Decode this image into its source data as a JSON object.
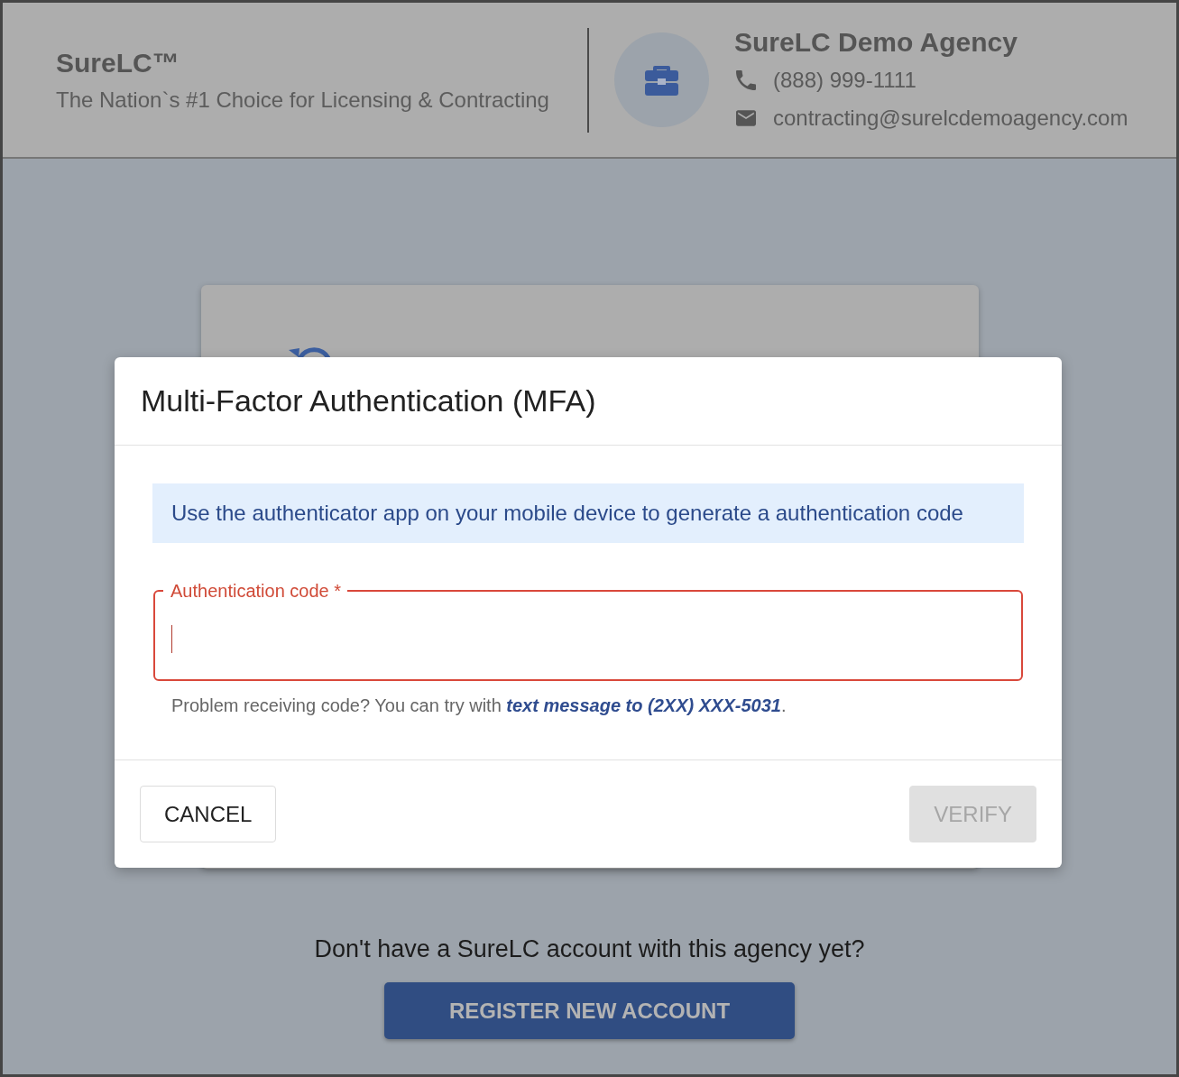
{
  "header": {
    "brand": {
      "name": "SureLC™",
      "tagline": "The Nation`s #1 Choice for Licensing & Contracting"
    },
    "agency": {
      "name": "SureLC Demo Agency",
      "contacts": [
        {
          "kind": "phone",
          "text": "(888) 999-1111"
        },
        {
          "kind": "email",
          "text": "contracting@surelcdemoagency.com"
        }
      ]
    }
  },
  "modal": {
    "title": "Multi-Factor Authentication (MFA)",
    "info": "Use the authenticator app on your mobile device to generate a authentication code",
    "field": {
      "label": "Authentication code *",
      "error": true,
      "focused": true
    },
    "help": {
      "text": "Problem receiving code? You can try with ",
      "link": "text message to (2XX) XXX-5031",
      "after": "."
    },
    "buttons": [
      {
        "label": "CANCEL",
        "kind": "outline",
        "disabled": false
      },
      {
        "label": "VERIFY",
        "kind": "primary",
        "disabled": true
      }
    ]
  },
  "register": {
    "prompt": "Don't have a SureLC account with this agency yet?",
    "button": "REGISTER NEW ACCOUNT"
  }
}
